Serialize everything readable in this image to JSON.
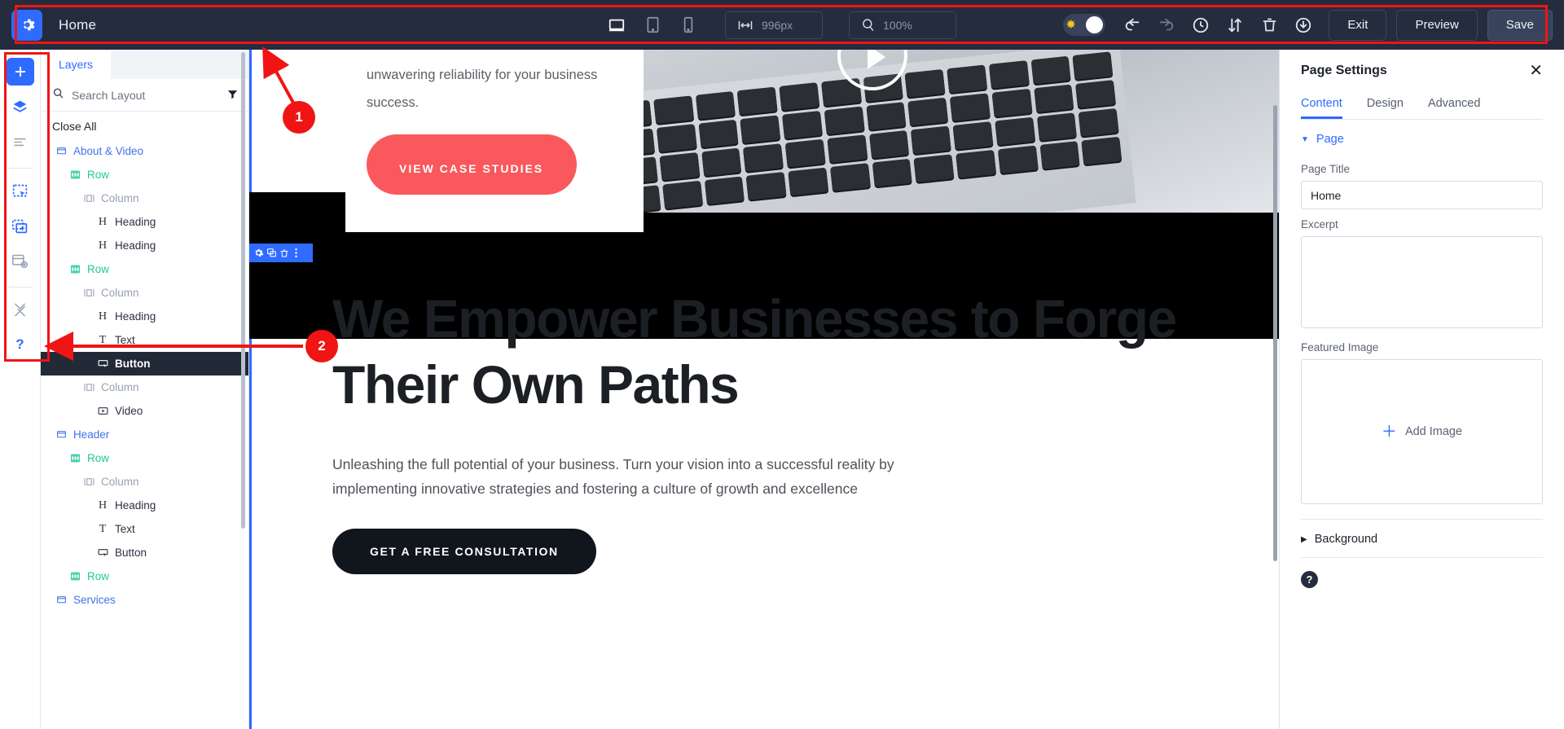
{
  "topbar": {
    "logo_icon": "gear-icon",
    "title": "Home",
    "devices": [
      {
        "name": "desktop",
        "icon": "desktop-icon",
        "active": true
      },
      {
        "name": "tablet",
        "icon": "tablet-icon",
        "active": false
      },
      {
        "name": "mobile",
        "icon": "mobile-icon",
        "active": false
      }
    ],
    "width_value": "996px",
    "zoom_value": "100%",
    "icons": [
      {
        "name": "undo-icon",
        "glyph": "↩"
      },
      {
        "name": "redo-icon",
        "glyph": "↪"
      },
      {
        "name": "history-icon",
        "glyph": "◷"
      },
      {
        "name": "sort-icon",
        "glyph": "↓↑"
      },
      {
        "name": "trash-icon",
        "glyph": "🗑"
      },
      {
        "name": "publish-icon",
        "glyph": "⏻"
      }
    ],
    "exit_label": "Exit",
    "preview_label": "Preview",
    "save_label": "Save",
    "dark_toggle_icon": "sun-icon"
  },
  "rail": {
    "items": [
      {
        "name": "add-element-button",
        "icon": "plus-icon",
        "style": "primary"
      },
      {
        "name": "layers-button",
        "icon": "layers-icon",
        "style": "blue"
      },
      {
        "name": "global-styles-button",
        "icon": "lines-icon",
        "style": "grey"
      },
      {
        "name": "templates-button",
        "icon": "template-click-icon",
        "style": "blue"
      },
      {
        "name": "blocks-button",
        "icon": "blocks-click-icon",
        "style": "blue"
      },
      {
        "name": "page-settings-button",
        "icon": "page-settings-icon",
        "style": "grey"
      },
      {
        "name": "tools-button",
        "icon": "wrench-icon",
        "style": "grey"
      },
      {
        "name": "help-button",
        "icon": "question-icon",
        "style": "blue"
      }
    ]
  },
  "layers": {
    "tab_label": "Layers",
    "search_placeholder": "Search Layout",
    "search_value": "",
    "filter_icon": "filter-icon",
    "close_all_label": "Close All",
    "tree": [
      {
        "label": "About & Video",
        "icon": "section-icon",
        "kind": "section",
        "depth": 0,
        "selected": false
      },
      {
        "label": "Row",
        "icon": "row-icon",
        "kind": "row",
        "depth": 1,
        "selected": false
      },
      {
        "label": "Column",
        "icon": "column-icon",
        "kind": "column",
        "depth": 2,
        "selected": false
      },
      {
        "label": "Heading",
        "icon": "heading-icon",
        "kind": "element",
        "depth": 3,
        "selected": false
      },
      {
        "label": "Heading",
        "icon": "heading-icon",
        "kind": "element",
        "depth": 3,
        "selected": false
      },
      {
        "label": "Row",
        "icon": "row-icon",
        "kind": "row",
        "depth": 1,
        "selected": false
      },
      {
        "label": "Column",
        "icon": "column-icon",
        "kind": "column",
        "depth": 2,
        "selected": false
      },
      {
        "label": "Heading",
        "icon": "heading-icon",
        "kind": "element",
        "depth": 3,
        "selected": false
      },
      {
        "label": "Text",
        "icon": "text-icon",
        "kind": "element",
        "depth": 3,
        "selected": false
      },
      {
        "label": "Button",
        "icon": "button-icon",
        "kind": "element",
        "depth": 3,
        "selected": true
      },
      {
        "label": "Column",
        "icon": "column-icon",
        "kind": "column",
        "depth": 2,
        "selected": false
      },
      {
        "label": "Video",
        "icon": "video-icon",
        "kind": "element",
        "depth": 3,
        "selected": false
      },
      {
        "label": "Header",
        "icon": "section-icon",
        "kind": "section",
        "depth": 0,
        "selected": false
      },
      {
        "label": "Row",
        "icon": "row-icon",
        "kind": "row",
        "depth": 1,
        "selected": false
      },
      {
        "label": "Column",
        "icon": "column-icon",
        "kind": "column",
        "depth": 2,
        "selected": false
      },
      {
        "label": "Heading",
        "icon": "heading-icon",
        "kind": "element",
        "depth": 3,
        "selected": false
      },
      {
        "label": "Text",
        "icon": "text-icon",
        "kind": "element",
        "depth": 3,
        "selected": false
      },
      {
        "label": "Button",
        "icon": "button-icon",
        "kind": "element",
        "depth": 3,
        "selected": false
      },
      {
        "label": "Row",
        "icon": "row-icon",
        "kind": "row",
        "depth": 1,
        "selected": false
      },
      {
        "label": "Services",
        "icon": "section-icon",
        "kind": "section",
        "depth": 0,
        "selected": false
      }
    ]
  },
  "canvas": {
    "about_card": {
      "paragraph": "unwavering reliability for your business success.",
      "button_label": "VIEW CASE STUDIES"
    },
    "element_toolbar": [
      {
        "name": "element-settings-icon",
        "glyph": "⚙"
      },
      {
        "name": "duplicate-icon",
        "glyph": "❐"
      },
      {
        "name": "delete-icon",
        "glyph": "🗑"
      },
      {
        "name": "more-options-icon",
        "glyph": "⋮"
      }
    ],
    "hero": {
      "heading": "We Empower Businesses to Forge Their Own Paths",
      "paragraph": "Unleashing the full potential of your business. Turn your vision into a successful reality by implementing innovative strategies and fostering a culture of growth and excellence",
      "button_label": "GET A FREE CONSULTATION"
    },
    "video_play_icon": "play-circle-icon"
  },
  "page_settings": {
    "title": "Page Settings",
    "close_icon": "close-icon",
    "tabs": [
      {
        "label": "Content",
        "active": true
      },
      {
        "label": "Design",
        "active": false
      },
      {
        "label": "Advanced",
        "active": false
      }
    ],
    "page_section_label": "Page",
    "page_title_label": "Page Title",
    "page_title_value": "Home",
    "excerpt_label": "Excerpt",
    "excerpt_value": "",
    "featured_image_label": "Featured Image",
    "add_image_label": "Add Image",
    "background_label": "Background",
    "help_icon": "question-circle-icon"
  },
  "annotations": [
    {
      "number": "1",
      "target": "topbar"
    },
    {
      "number": "2",
      "target": "left-rail"
    }
  ],
  "colors": {
    "topbar_bg": "#242c3d",
    "accent_blue": "#2f6bff",
    "annotation_red": "#f01414",
    "row_green": "#22c79c",
    "case_button_red": "#f9585c"
  }
}
